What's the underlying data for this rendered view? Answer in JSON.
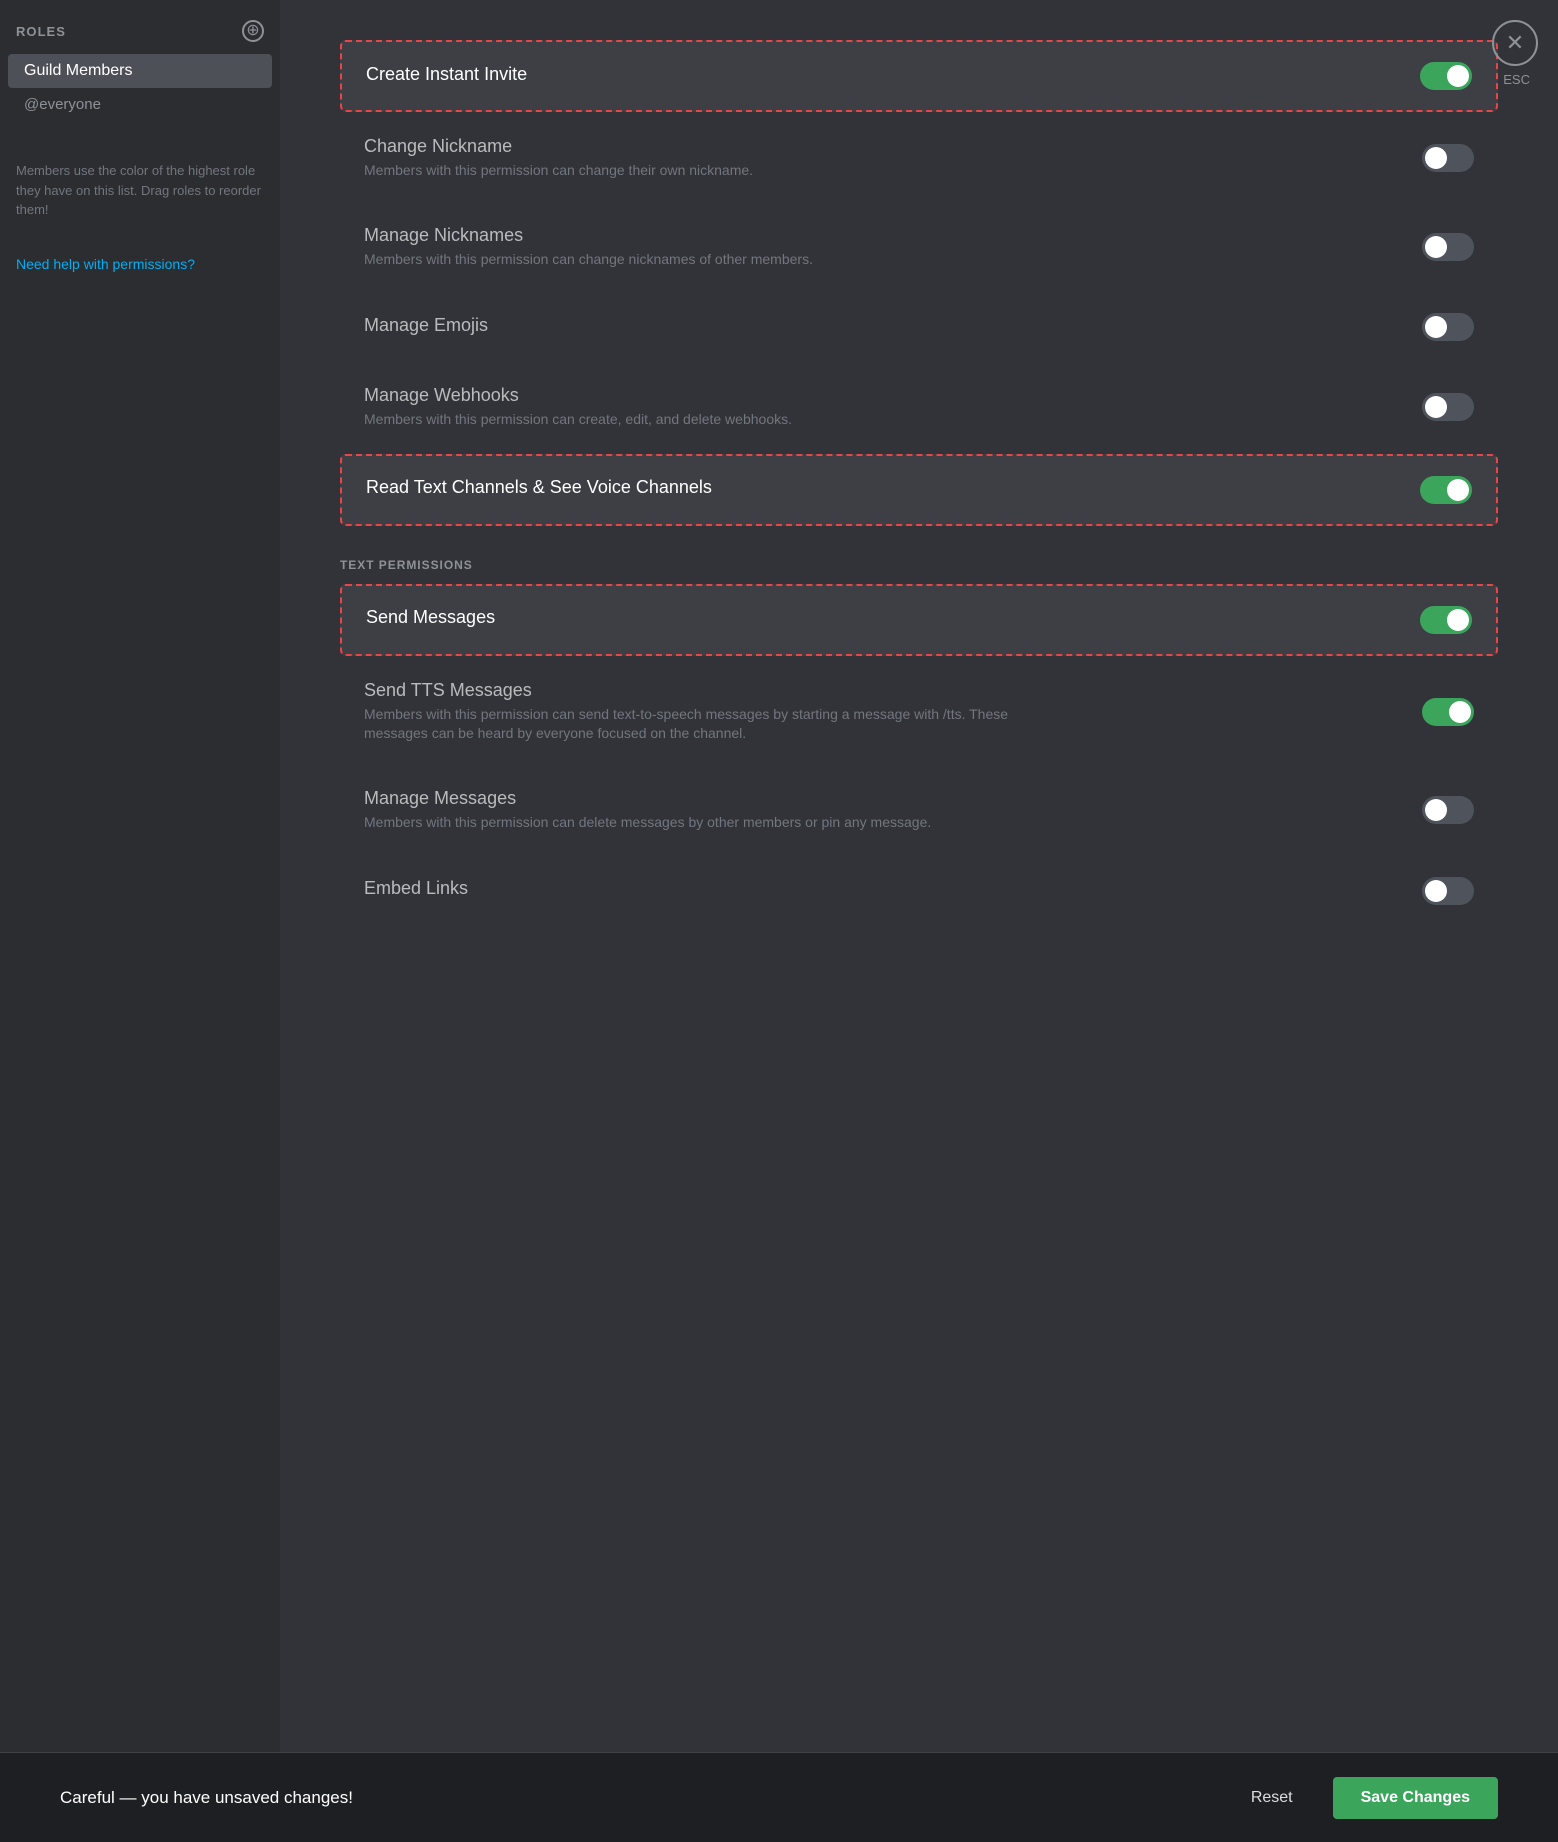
{
  "sidebar": {
    "roles_label": "ROLES",
    "add_icon": "+",
    "active_role": "Guild Members",
    "everyone_label": "@everyone",
    "info_text": "Members use the color of the highest role they have on this list. Drag roles to reorder them!",
    "help_link": "Need help with permissions?"
  },
  "close_label": "✕",
  "esc_label": "ESC",
  "permissions": [
    {
      "id": "create-instant-invite",
      "label": "Create Instant Invite",
      "desc": "",
      "state": "on",
      "highlighted": true,
      "section": null
    },
    {
      "id": "change-nickname",
      "label": "Change Nickname",
      "desc": "Members with this permission can change their own nickname.",
      "state": "off",
      "highlighted": false,
      "section": null
    },
    {
      "id": "manage-nicknames",
      "label": "Manage Nicknames",
      "desc": "Members with this permission can change nicknames of other members.",
      "state": "off",
      "highlighted": false,
      "section": null
    },
    {
      "id": "manage-emojis",
      "label": "Manage Emojis",
      "desc": "",
      "state": "off",
      "highlighted": false,
      "section": null
    },
    {
      "id": "manage-webhooks",
      "label": "Manage Webhooks",
      "desc": "Members with this permission can create, edit, and delete webhooks.",
      "state": "off",
      "highlighted": false,
      "section": null
    },
    {
      "id": "read-text-channels",
      "label": "Read Text Channels & See Voice Channels",
      "desc": "",
      "state": "on",
      "highlighted": true,
      "section": null
    },
    {
      "id": "send-messages",
      "label": "Send Messages",
      "desc": "",
      "state": "on",
      "highlighted": true,
      "section": "TEXT PERMISSIONS"
    },
    {
      "id": "send-tts-messages",
      "label": "Send TTS Messages",
      "desc": "Members with this permission can send text-to-speech messages by starting a message with /tts. These messages can be heard by everyone focused on the channel.",
      "state": "on",
      "highlighted": false,
      "section": null
    },
    {
      "id": "manage-messages",
      "label": "Manage Messages",
      "desc": "Members with this permission can delete messages by other members or pin any message.",
      "state": "off",
      "highlighted": false,
      "section": null
    },
    {
      "id": "embed-links",
      "label": "Embed Links",
      "desc": "",
      "state": "off",
      "highlighted": false,
      "section": null
    }
  ],
  "bottom_bar": {
    "warning": "Careful — you have unsaved changes!",
    "reset_label": "Reset",
    "save_label": "Save Changes"
  }
}
